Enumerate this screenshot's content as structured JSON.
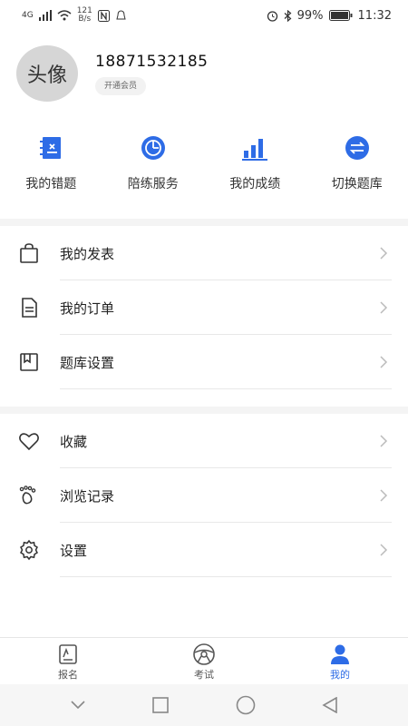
{
  "status_bar": {
    "signal": "4G",
    "net_speed_value": "121",
    "net_speed_unit": "B/s",
    "battery": "99%",
    "time": "11:32"
  },
  "profile": {
    "avatar_text": "头像",
    "phone": "18871532185",
    "member_badge": "开通会员"
  },
  "quick_actions": [
    {
      "label": "我的错题",
      "icon": "notebook-icon"
    },
    {
      "label": "陪练服务",
      "icon": "timer-icon"
    },
    {
      "label": "我的成绩",
      "icon": "bar-chart-icon"
    },
    {
      "label": "切换题库",
      "icon": "switch-icon"
    }
  ],
  "menu_group_1": [
    {
      "label": "我的发表",
      "icon": "bag-icon"
    },
    {
      "label": "我的订单",
      "icon": "document-icon"
    },
    {
      "label": "题库设置",
      "icon": "book-icon"
    }
  ],
  "menu_group_2": [
    {
      "label": "收藏",
      "icon": "heart-icon"
    },
    {
      "label": "浏览记录",
      "icon": "footprint-icon"
    },
    {
      "label": "设置",
      "icon": "gear-icon"
    }
  ],
  "bottom_tabs": [
    {
      "label": "报名",
      "icon": "register-icon"
    },
    {
      "label": "考试",
      "icon": "steering-wheel-icon"
    },
    {
      "label": "我的",
      "icon": "person-icon",
      "active": true
    }
  ],
  "colors": {
    "accent": "#2e6ce6",
    "divider": "#f4f4f4"
  }
}
